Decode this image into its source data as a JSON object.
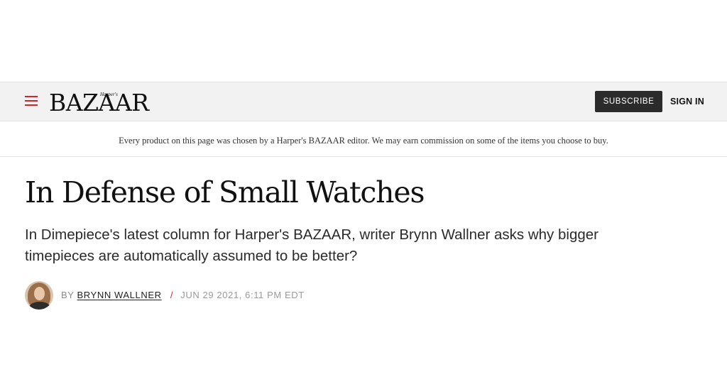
{
  "header": {
    "menu_icon": "hamburger-menu-icon",
    "logo_sup": "Harper's",
    "logo_main": "BAZAAR",
    "subscribe_label": "SUBSCRIBE",
    "signin_label": "SIGN IN",
    "accent_color": "#d0262d",
    "button_color": "#2b2b2b"
  },
  "disclaimer": {
    "text": "Every product on this page was chosen by a Harper's BAZAAR editor. We may earn commission on some of the items you choose to buy."
  },
  "article": {
    "headline": "In Defense of Small Watches",
    "dek": "In Dimepiece's latest column for Harper's BAZAAR, writer Brynn Wallner asks why bigger timepieces are automatically assumed to be better?",
    "byline": {
      "prefix": "BY",
      "author": "BRYNN WALLNER",
      "separator": "/",
      "date": "JUN 29 2021, 6:11 PM EDT"
    }
  }
}
